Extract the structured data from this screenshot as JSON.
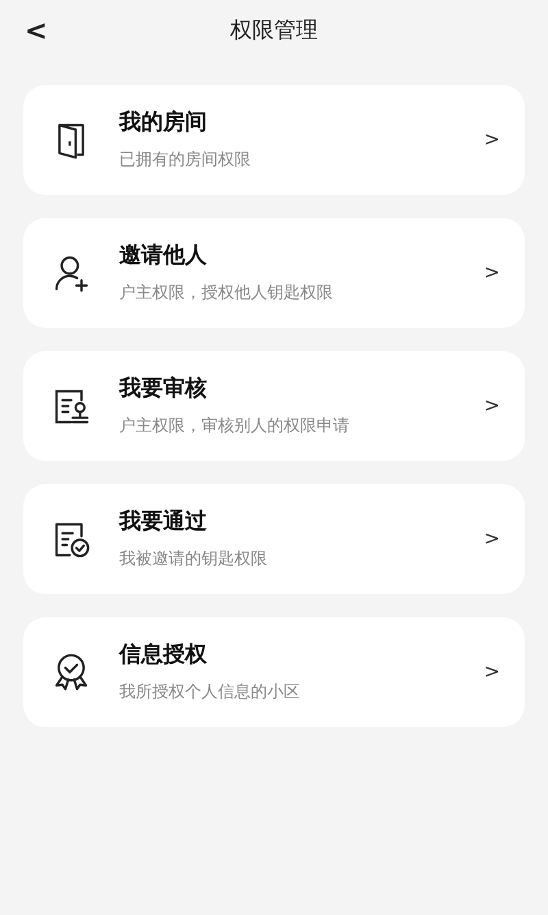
{
  "header": {
    "back": "<",
    "title": "权限管理"
  },
  "items": [
    {
      "kind": "door",
      "title": "我的房间",
      "subtitle": "已拥有的房间权限",
      "chevron": ">"
    },
    {
      "kind": "person",
      "title": "邀请他人",
      "subtitle": "户主权限，授权他人钥匙权限",
      "chevron": ">"
    },
    {
      "kind": "review",
      "title": "我要审核",
      "subtitle": "户主权限，审核别人的权限申请",
      "chevron": ">"
    },
    {
      "kind": "approve",
      "title": "我要通过",
      "subtitle": "我被邀请的钥匙权限",
      "chevron": ">"
    },
    {
      "kind": "badge",
      "title": "信息授权",
      "subtitle": "我所授权个人信息的小区",
      "chevron": ">"
    }
  ]
}
